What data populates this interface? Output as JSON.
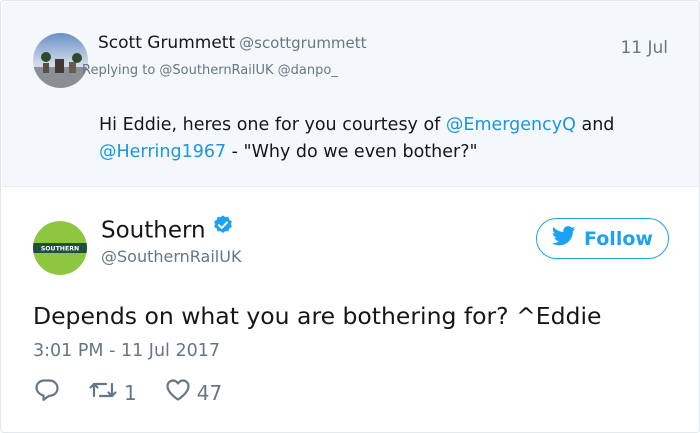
{
  "reply_context": {
    "name": "Scott Grummett",
    "handle": "@scottgrummett",
    "date": "11 Jul",
    "replying_to": "Replying to @SouthernRailUK @danpo_",
    "text_intro": "Hi Eddie, heres one for you courtesy of ",
    "mention_1": "@EmergencyQ",
    "text_and": " and ",
    "mention_2": "@Herring1967",
    "text_quote": " - \"Why do we even bother?\""
  },
  "tweet": {
    "name": "Southern",
    "handle": "@SouthernRailUK",
    "follow_label": "Follow",
    "text": "Depends on what you are bothering for? ^Eddie",
    "timestamp": "3:01 PM - 11 Jul 2017",
    "retweet_count": "1",
    "like_count": "47",
    "logo_text": "SOUTHERN"
  },
  "colors": {
    "accent": "#1da1f2",
    "mention": "#1b95e0",
    "muted": "#657786",
    "southern_green": "#8dc63f",
    "southern_dark": "#1d4f3a"
  },
  "icons": [
    "verified-icon",
    "twitter-bird-icon",
    "reply-icon",
    "retweet-icon",
    "like-icon"
  ]
}
